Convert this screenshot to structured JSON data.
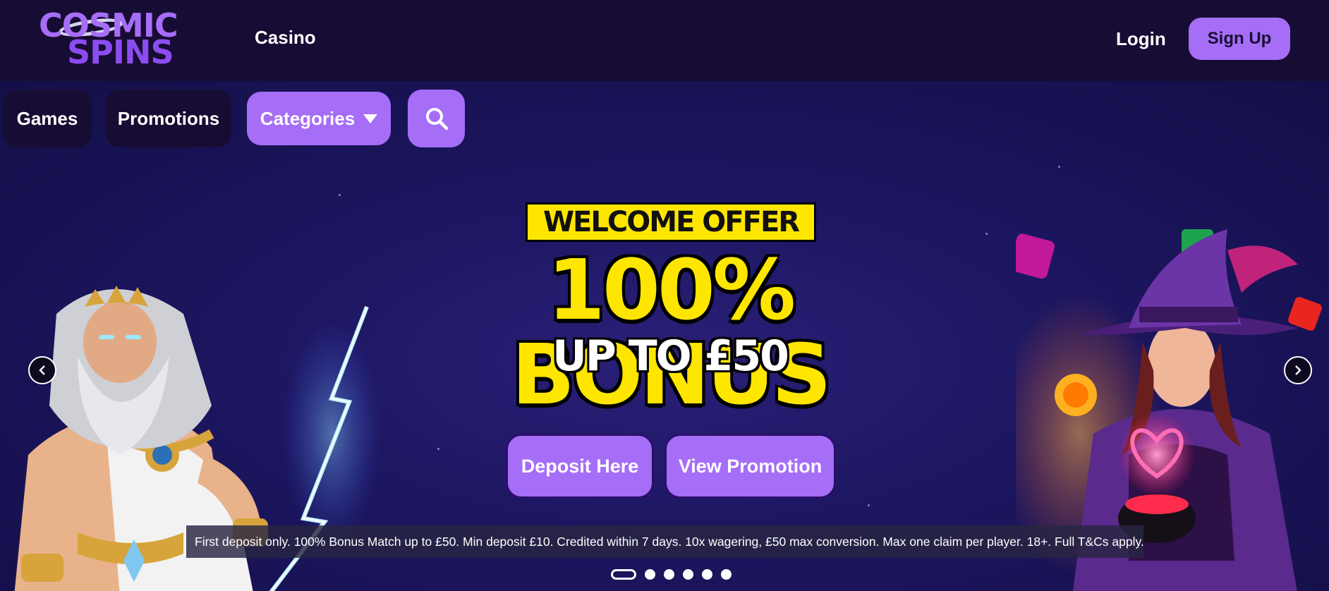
{
  "header": {
    "logo_line1": "COSMIC",
    "logo_line2": "SPINS",
    "nav_casino": "Casino",
    "login_label": "Login",
    "signup_label": "Sign Up"
  },
  "subnav": {
    "games": "Games",
    "promotions": "Promotions",
    "categories": "Categories",
    "search_icon": "search-icon"
  },
  "hero": {
    "badge": "WELCOME OFFER",
    "headline": "100% BONUS",
    "subheadline": "UP TO £50",
    "deposit_button": "Deposit Here",
    "promotion_button": "View Promotion",
    "terms": "First deposit only. 100% Bonus Match up to £50. Min deposit £10. Credited within 7 days. 10x wagering, £50 max conversion. Max one claim per player. 18+. Full T&Cs apply.",
    "prev_icon": "chevron-left-icon",
    "next_icon": "chevron-right-icon",
    "slides_total": 6,
    "active_slide": 1
  },
  "colors": {
    "accent": "#a66df7",
    "header_bg": "#170c33",
    "hero_bg": "#1c1660",
    "offer_yellow": "#ffe600"
  }
}
